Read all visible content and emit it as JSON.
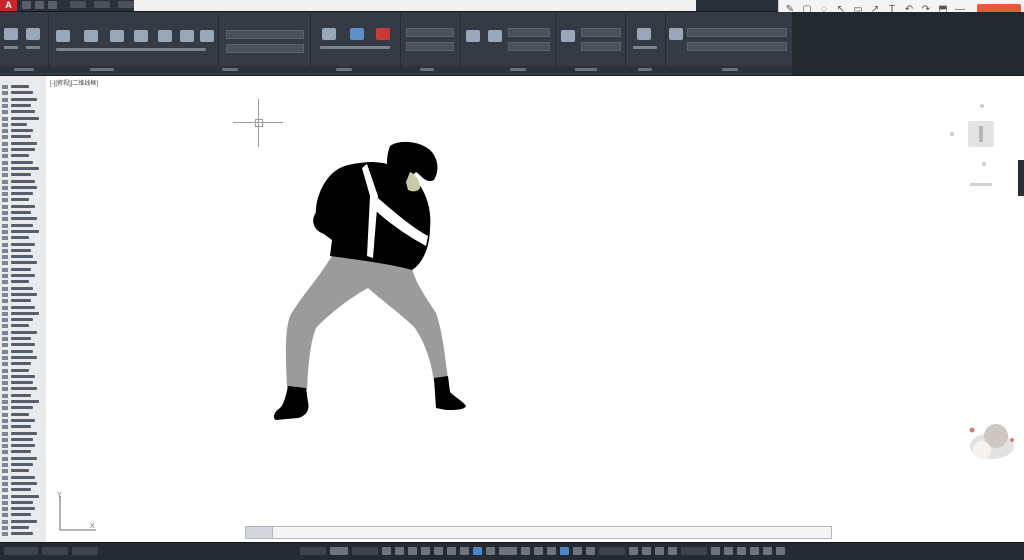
{
  "app": {
    "logo_letter": "A",
    "title": "",
    "brand_color": "#c9232b"
  },
  "annotation_toolbar": {
    "icons": [
      "pen-icon",
      "shape-icon",
      "eraser-icon",
      "cursor-icon",
      "rectangle-icon",
      "arrow-icon",
      "text-icon",
      "undo-icon",
      "redo-icon",
      "save-icon",
      "minimize-icon"
    ],
    "glyphs": [
      "✎",
      "▢",
      "◌",
      "↖",
      "▭",
      "↗",
      "T",
      "↶",
      "↷",
      "⬒",
      "—"
    ],
    "accent_color": "#e35a3c"
  },
  "canvas": {
    "viewport_label": "[-][俯视][二维线框]",
    "background": "#ffffff"
  },
  "figure": {
    "jacket_color": "#000000",
    "pants_color": "#9b9b9b",
    "skin_color": "#c9c9a8"
  },
  "ucs": {
    "y_label": "Y",
    "x_label": "X"
  },
  "statusbar": {
    "accent_color": "#4a86c8"
  }
}
